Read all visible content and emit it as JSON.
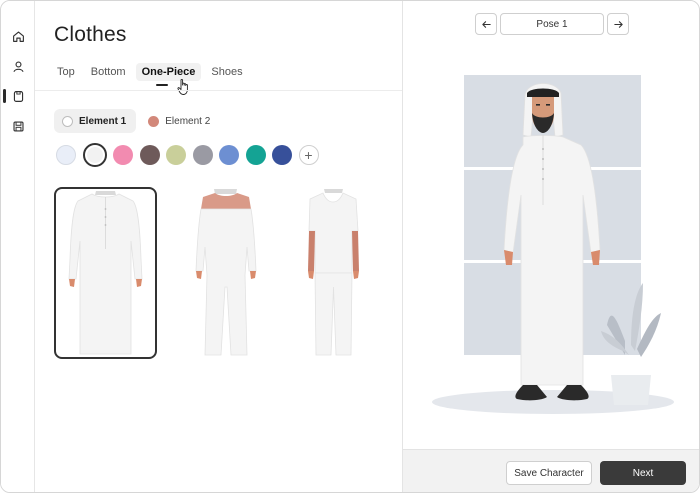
{
  "app": {
    "rail_icons": [
      "home-icon",
      "user-icon",
      "shirt-icon",
      "save-icon"
    ],
    "active_rail": "shirt-icon"
  },
  "panel": {
    "title": "Clothes",
    "tabs": [
      {
        "label": "Top",
        "active": false
      },
      {
        "label": "Bottom",
        "active": false
      },
      {
        "label": "One-Piece",
        "active": true
      },
      {
        "label": "Shoes",
        "active": false
      }
    ],
    "elements": [
      {
        "label": "Element 1",
        "active": true,
        "dot_color": "#ffffff"
      },
      {
        "label": "Element 2",
        "active": false,
        "dot_color": "#d2887a"
      }
    ],
    "swatches": [
      {
        "color": "#e9eef8",
        "selected": false
      },
      {
        "color": "#f2f2f2",
        "selected": true
      },
      {
        "color": "#f28bb0",
        "selected": false
      },
      {
        "color": "#6e5a5a",
        "selected": false
      },
      {
        "color": "#c9cf9a",
        "selected": false
      },
      {
        "color": "#9a9aa3",
        "selected": false
      },
      {
        "color": "#6d8fd2",
        "selected": false
      },
      {
        "color": "#14a394",
        "selected": false
      },
      {
        "color": "#37509a",
        "selected": false
      }
    ],
    "add_swatch_label": "+",
    "outfits": [
      {
        "name": "thobe",
        "selected": true
      },
      {
        "name": "jumpsuit",
        "selected": false
      },
      {
        "name": "shirt-and-pants",
        "selected": false
      }
    ]
  },
  "preview": {
    "pose_label": "Pose 1",
    "save_label": "Save Character",
    "next_label": "Next"
  },
  "colors": {
    "accent_dark": "#3a3a3a",
    "window_panel": "#d8dde4",
    "floor": "#e4e7ec",
    "garment": "#f4f4f4"
  }
}
